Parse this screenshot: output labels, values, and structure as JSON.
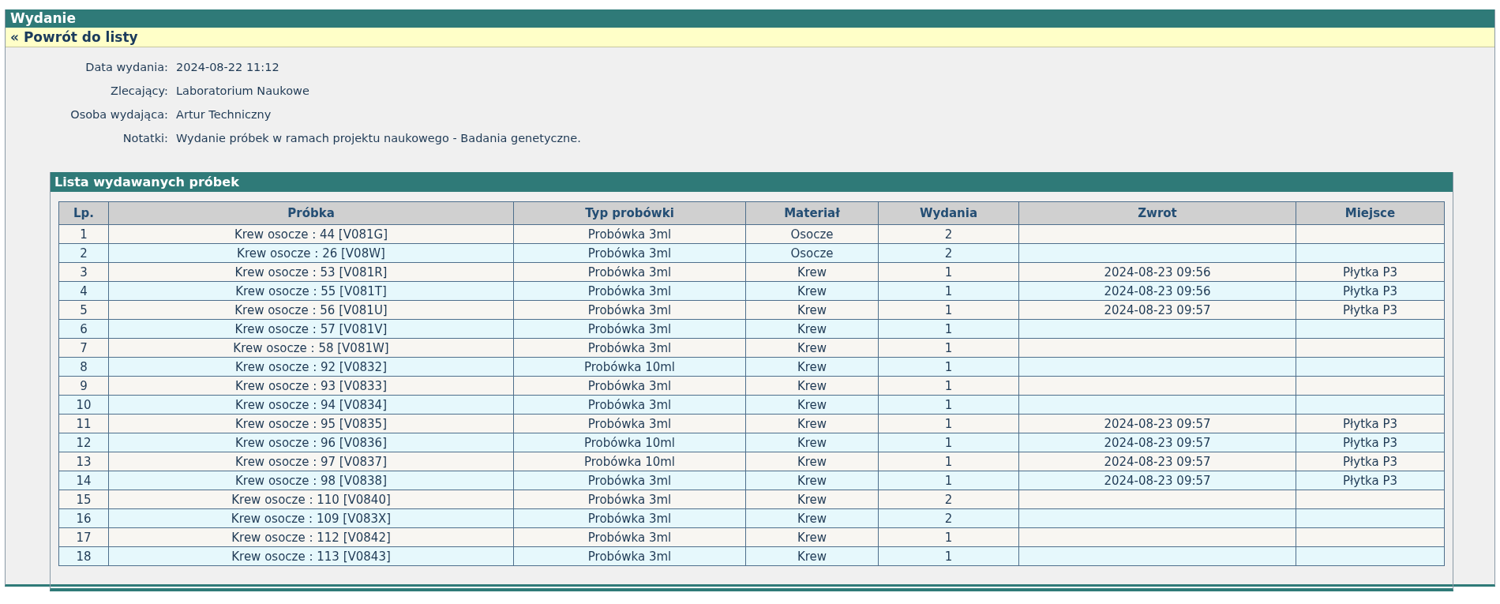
{
  "window": {
    "title": "Wydanie"
  },
  "back_link": "« Powrót do listy",
  "details": [
    {
      "label": "Data wydania:",
      "value": "2024-08-22 11:12"
    },
    {
      "label": "Zlecający:",
      "value": "Laboratorium Naukowe"
    },
    {
      "label": "Osoba wydająca:",
      "value": "Artur Techniczny"
    },
    {
      "label": "Notatki:",
      "value": "Wydanie próbek w ramach projektu naukowego - Badania genetyczne."
    }
  ],
  "panel": {
    "title": "Lista wydawanych próbek"
  },
  "table": {
    "columns": [
      "Lp.",
      "Próbka",
      "Typ probówki",
      "Materiał",
      "Wydania",
      "Zwrot",
      "Miejsce"
    ],
    "rows": [
      [
        "1",
        "Krew osocze : 44 [V081G]",
        "Probówka 3ml",
        "Osocze",
        "2"
      ],
      [
        "2",
        "Krew osocze : 26 [V08W]",
        "Probówka 3ml",
        "Osocze",
        "2"
      ],
      [
        "3",
        "Krew osocze : 53 [V081R]",
        "Probówka 3ml",
        "Krew",
        "1",
        "2024-08-23 09:56",
        "Płytka P3"
      ],
      [
        "4",
        "Krew osocze : 55 [V081T]",
        "Probówka 3ml",
        "Krew",
        "1",
        "2024-08-23 09:56",
        "Płytka P3"
      ],
      [
        "5",
        "Krew osocze : 56 [V081U]",
        "Probówka 3ml",
        "Krew",
        "1",
        "2024-08-23 09:57",
        "Płytka P3"
      ],
      [
        "6",
        "Krew osocze : 57 [V081V]",
        "Probówka 3ml",
        "Krew",
        "1"
      ],
      [
        "7",
        "Krew osocze : 58 [V081W]",
        "Probówka 3ml",
        "Krew",
        "1"
      ],
      [
        "8",
        "Krew osocze : 92 [V0832]",
        "Probówka 10ml",
        "Krew",
        "1"
      ],
      [
        "9",
        "Krew osocze : 93 [V0833]",
        "Probówka 3ml",
        "Krew",
        "1"
      ],
      [
        "10",
        "Krew osocze : 94 [V0834]",
        "Probówka 3ml",
        "Krew",
        "1"
      ],
      [
        "11",
        "Krew osocze : 95 [V0835]",
        "Probówka 3ml",
        "Krew",
        "1",
        "2024-08-23 09:57",
        "Płytka P3"
      ],
      [
        "12",
        "Krew osocze : 96 [V0836]",
        "Probówka 10ml",
        "Krew",
        "1",
        "2024-08-23 09:57",
        "Płytka P3"
      ],
      [
        "13",
        "Krew osocze : 97 [V0837]",
        "Probówka 10ml",
        "Krew",
        "1",
        "2024-08-23 09:57",
        "Płytka P3"
      ],
      [
        "14",
        "Krew osocze : 98 [V0838]",
        "Probówka 3ml",
        "Krew",
        "1",
        "2024-08-23 09:57",
        "Płytka P3"
      ],
      [
        "15",
        "Krew osocze : 110 [V0840]",
        "Probówka 3ml",
        "Krew",
        "2"
      ],
      [
        "16",
        "Krew osocze : 109 [V083X]",
        "Probówka 3ml",
        "Krew",
        "2"
      ],
      [
        "17",
        "Krew osocze : 112 [V0842]",
        "Probówka 3ml",
        "Krew",
        "1"
      ],
      [
        "18",
        "Krew osocze : 113 [V0843]",
        "Probówka 3ml",
        "Krew",
        "1"
      ]
    ]
  }
}
